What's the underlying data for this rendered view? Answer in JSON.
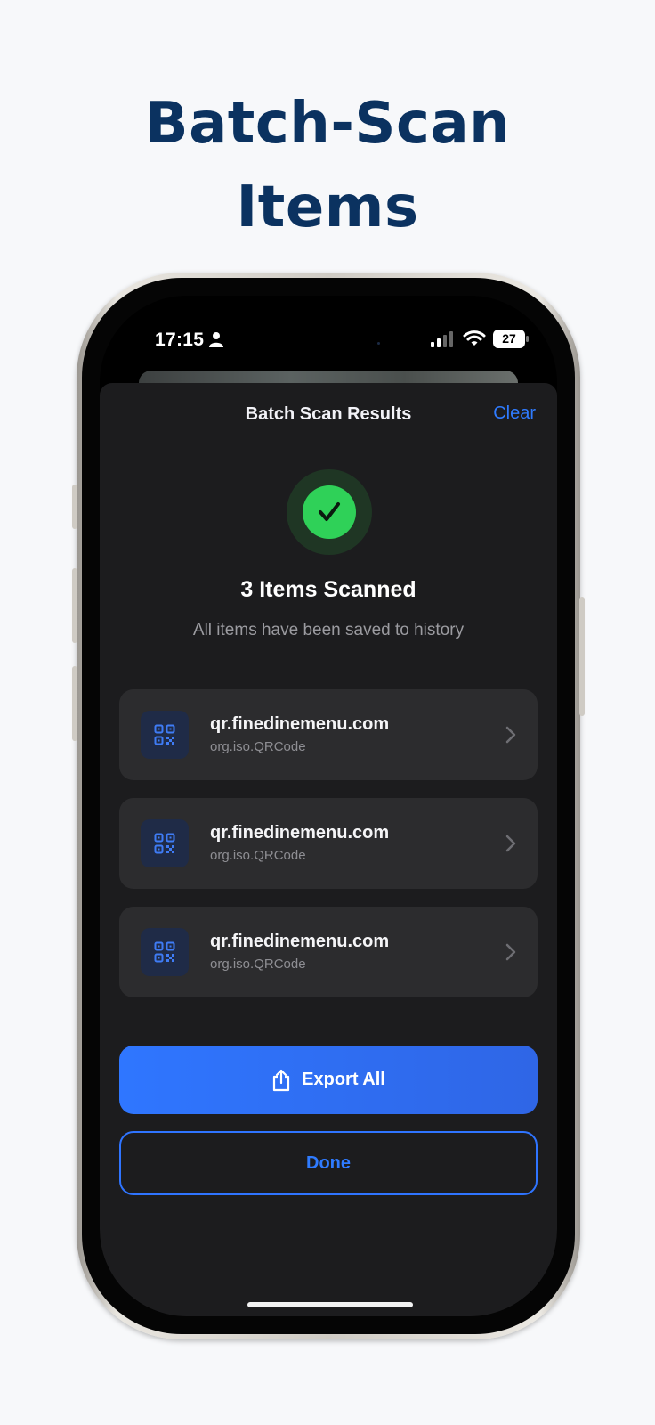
{
  "headline": {
    "line1": "Batch-Scan",
    "line2": "Items"
  },
  "status_bar": {
    "time": "17:15",
    "battery": "27"
  },
  "sheet": {
    "title": "Batch Scan Results",
    "clear_label": "Clear"
  },
  "summary": {
    "title": "3 Items Scanned",
    "subtitle": "All items have been saved to history"
  },
  "results": [
    {
      "title": "qr.finedinemenu.com",
      "type": "org.iso.QRCode"
    },
    {
      "title": "qr.finedinemenu.com",
      "type": "org.iso.QRCode"
    },
    {
      "title": "qr.finedinemenu.com",
      "type": "org.iso.QRCode"
    }
  ],
  "actions": {
    "export_label": "Export All",
    "done_label": "Done"
  },
  "colors": {
    "accent": "#2F7BFF",
    "success": "#2FD158",
    "headline": "#0B3260",
    "sheet_background": "#1C1C1E",
    "card_background": "#2C2C2E"
  },
  "icons": [
    "person-icon",
    "signal-icon",
    "wifi-icon",
    "battery-icon",
    "checkmark-icon",
    "qr-code-icon",
    "chevron-right-icon",
    "share-icon"
  ]
}
